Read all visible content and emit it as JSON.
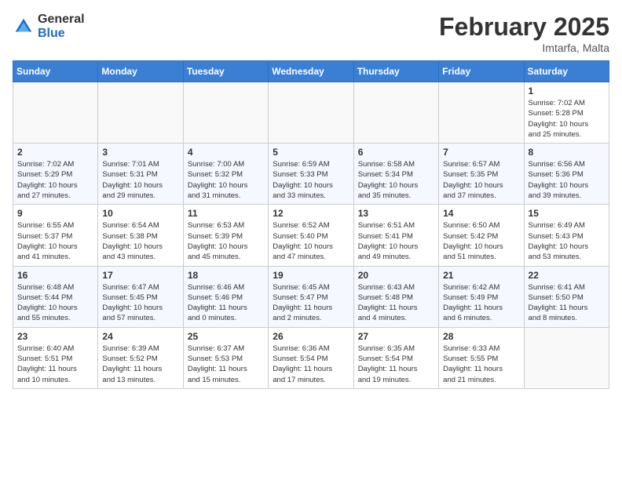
{
  "header": {
    "logo_general": "General",
    "logo_blue": "Blue",
    "month_title": "February 2025",
    "location": "Imtarfa, Malta"
  },
  "weekdays": [
    "Sunday",
    "Monday",
    "Tuesday",
    "Wednesday",
    "Thursday",
    "Friday",
    "Saturday"
  ],
  "weeks": [
    [
      {
        "day": "",
        "info": ""
      },
      {
        "day": "",
        "info": ""
      },
      {
        "day": "",
        "info": ""
      },
      {
        "day": "",
        "info": ""
      },
      {
        "day": "",
        "info": ""
      },
      {
        "day": "",
        "info": ""
      },
      {
        "day": "1",
        "info": "Sunrise: 7:02 AM\nSunset: 5:28 PM\nDaylight: 10 hours\nand 25 minutes."
      }
    ],
    [
      {
        "day": "2",
        "info": "Sunrise: 7:02 AM\nSunset: 5:29 PM\nDaylight: 10 hours\nand 27 minutes."
      },
      {
        "day": "3",
        "info": "Sunrise: 7:01 AM\nSunset: 5:31 PM\nDaylight: 10 hours\nand 29 minutes."
      },
      {
        "day": "4",
        "info": "Sunrise: 7:00 AM\nSunset: 5:32 PM\nDaylight: 10 hours\nand 31 minutes."
      },
      {
        "day": "5",
        "info": "Sunrise: 6:59 AM\nSunset: 5:33 PM\nDaylight: 10 hours\nand 33 minutes."
      },
      {
        "day": "6",
        "info": "Sunrise: 6:58 AM\nSunset: 5:34 PM\nDaylight: 10 hours\nand 35 minutes."
      },
      {
        "day": "7",
        "info": "Sunrise: 6:57 AM\nSunset: 5:35 PM\nDaylight: 10 hours\nand 37 minutes."
      },
      {
        "day": "8",
        "info": "Sunrise: 6:56 AM\nSunset: 5:36 PM\nDaylight: 10 hours\nand 39 minutes."
      }
    ],
    [
      {
        "day": "9",
        "info": "Sunrise: 6:55 AM\nSunset: 5:37 PM\nDaylight: 10 hours\nand 41 minutes."
      },
      {
        "day": "10",
        "info": "Sunrise: 6:54 AM\nSunset: 5:38 PM\nDaylight: 10 hours\nand 43 minutes."
      },
      {
        "day": "11",
        "info": "Sunrise: 6:53 AM\nSunset: 5:39 PM\nDaylight: 10 hours\nand 45 minutes."
      },
      {
        "day": "12",
        "info": "Sunrise: 6:52 AM\nSunset: 5:40 PM\nDaylight: 10 hours\nand 47 minutes."
      },
      {
        "day": "13",
        "info": "Sunrise: 6:51 AM\nSunset: 5:41 PM\nDaylight: 10 hours\nand 49 minutes."
      },
      {
        "day": "14",
        "info": "Sunrise: 6:50 AM\nSunset: 5:42 PM\nDaylight: 10 hours\nand 51 minutes."
      },
      {
        "day": "15",
        "info": "Sunrise: 6:49 AM\nSunset: 5:43 PM\nDaylight: 10 hours\nand 53 minutes."
      }
    ],
    [
      {
        "day": "16",
        "info": "Sunrise: 6:48 AM\nSunset: 5:44 PM\nDaylight: 10 hours\nand 55 minutes."
      },
      {
        "day": "17",
        "info": "Sunrise: 6:47 AM\nSunset: 5:45 PM\nDaylight: 10 hours\nand 57 minutes."
      },
      {
        "day": "18",
        "info": "Sunrise: 6:46 AM\nSunset: 5:46 PM\nDaylight: 11 hours\nand 0 minutes."
      },
      {
        "day": "19",
        "info": "Sunrise: 6:45 AM\nSunset: 5:47 PM\nDaylight: 11 hours\nand 2 minutes."
      },
      {
        "day": "20",
        "info": "Sunrise: 6:43 AM\nSunset: 5:48 PM\nDaylight: 11 hours\nand 4 minutes."
      },
      {
        "day": "21",
        "info": "Sunrise: 6:42 AM\nSunset: 5:49 PM\nDaylight: 11 hours\nand 6 minutes."
      },
      {
        "day": "22",
        "info": "Sunrise: 6:41 AM\nSunset: 5:50 PM\nDaylight: 11 hours\nand 8 minutes."
      }
    ],
    [
      {
        "day": "23",
        "info": "Sunrise: 6:40 AM\nSunset: 5:51 PM\nDaylight: 11 hours\nand 10 minutes."
      },
      {
        "day": "24",
        "info": "Sunrise: 6:39 AM\nSunset: 5:52 PM\nDaylight: 11 hours\nand 13 minutes."
      },
      {
        "day": "25",
        "info": "Sunrise: 6:37 AM\nSunset: 5:53 PM\nDaylight: 11 hours\nand 15 minutes."
      },
      {
        "day": "26",
        "info": "Sunrise: 6:36 AM\nSunset: 5:54 PM\nDaylight: 11 hours\nand 17 minutes."
      },
      {
        "day": "27",
        "info": "Sunrise: 6:35 AM\nSunset: 5:54 PM\nDaylight: 11 hours\nand 19 minutes."
      },
      {
        "day": "28",
        "info": "Sunrise: 6:33 AM\nSunset: 5:55 PM\nDaylight: 11 hours\nand 21 minutes."
      },
      {
        "day": "",
        "info": ""
      }
    ]
  ]
}
